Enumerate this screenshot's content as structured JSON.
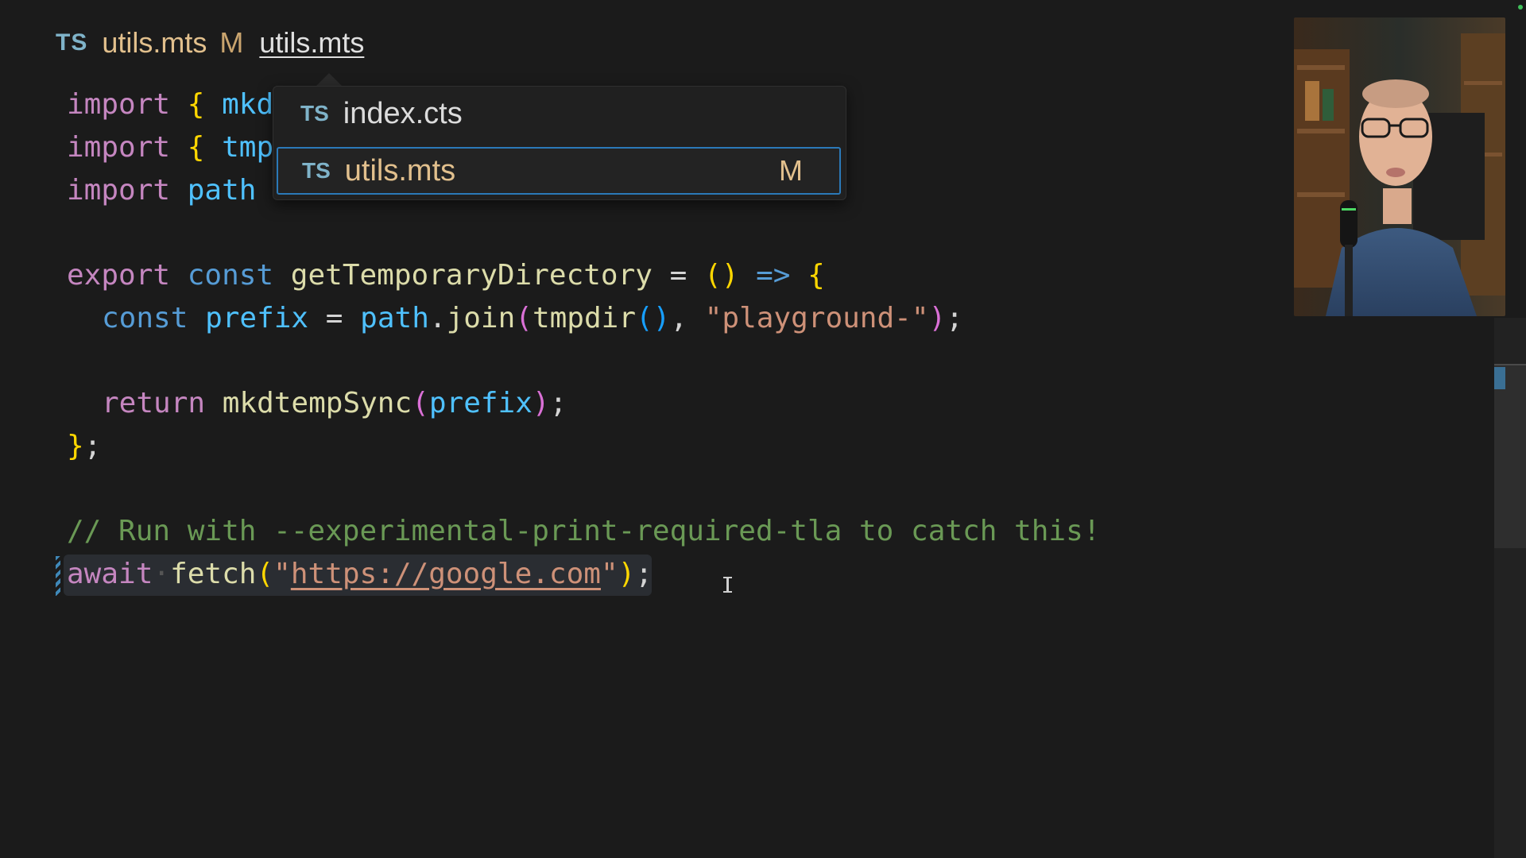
{
  "tab": {
    "lang_badge": "TS",
    "filename": "utils.mts",
    "status": "M",
    "breadcrumb": "utils.mts"
  },
  "dropdown": {
    "items": [
      {
        "badge": "TS",
        "label": "index.cts",
        "status": ""
      },
      {
        "badge": "TS",
        "label": "utils.mts",
        "status": "M"
      }
    ],
    "selected_index": 1
  },
  "code": {
    "line1": {
      "kw": "import",
      "b1": "{",
      "id": "mkd"
    },
    "line2": {
      "kw": "import",
      "b1": "{",
      "id": "tmp"
    },
    "line3": {
      "kw": "import",
      "id": "path"
    },
    "line5": {
      "kw": "export",
      "kw2": "const",
      "name": "getTemporaryDirectory",
      "eq": "=",
      "paren": "()",
      "arrow": "=>",
      "brace": "{"
    },
    "line6": {
      "kw": "const",
      "var": "prefix",
      "eq": "=",
      "obj": "path",
      "dot": ".",
      "fn": "join",
      "p1": "(",
      "fn2": "tmpdir",
      "p2": "()",
      "comma": ",",
      "str": "\"playground-\"",
      "p3": ")",
      "semi": ";"
    },
    "line8": {
      "kw": "return",
      "fn": "mkdtempSync",
      "p1": "(",
      "arg": "prefix",
      "p2": ")",
      "semi": ";"
    },
    "line9": {
      "brace": "}",
      "semi": ";"
    },
    "line11": {
      "comment": "// Run with --experimental-print-required-tla to catch this!"
    },
    "line12": {
      "kw": "await",
      "ws": "·",
      "fn": "fetch",
      "p1": "(",
      "q1": "\"",
      "url": "https://google.com",
      "q2": "\"",
      "p2": ")",
      "semi": ";"
    }
  },
  "colors": {
    "background": "#1b1b1b",
    "keyword": "#c586c0",
    "storage": "#569cd6",
    "function": "#dcdcaa",
    "string": "#ce9178",
    "comment": "#6a9955",
    "selection_border": "#2b79b8"
  }
}
